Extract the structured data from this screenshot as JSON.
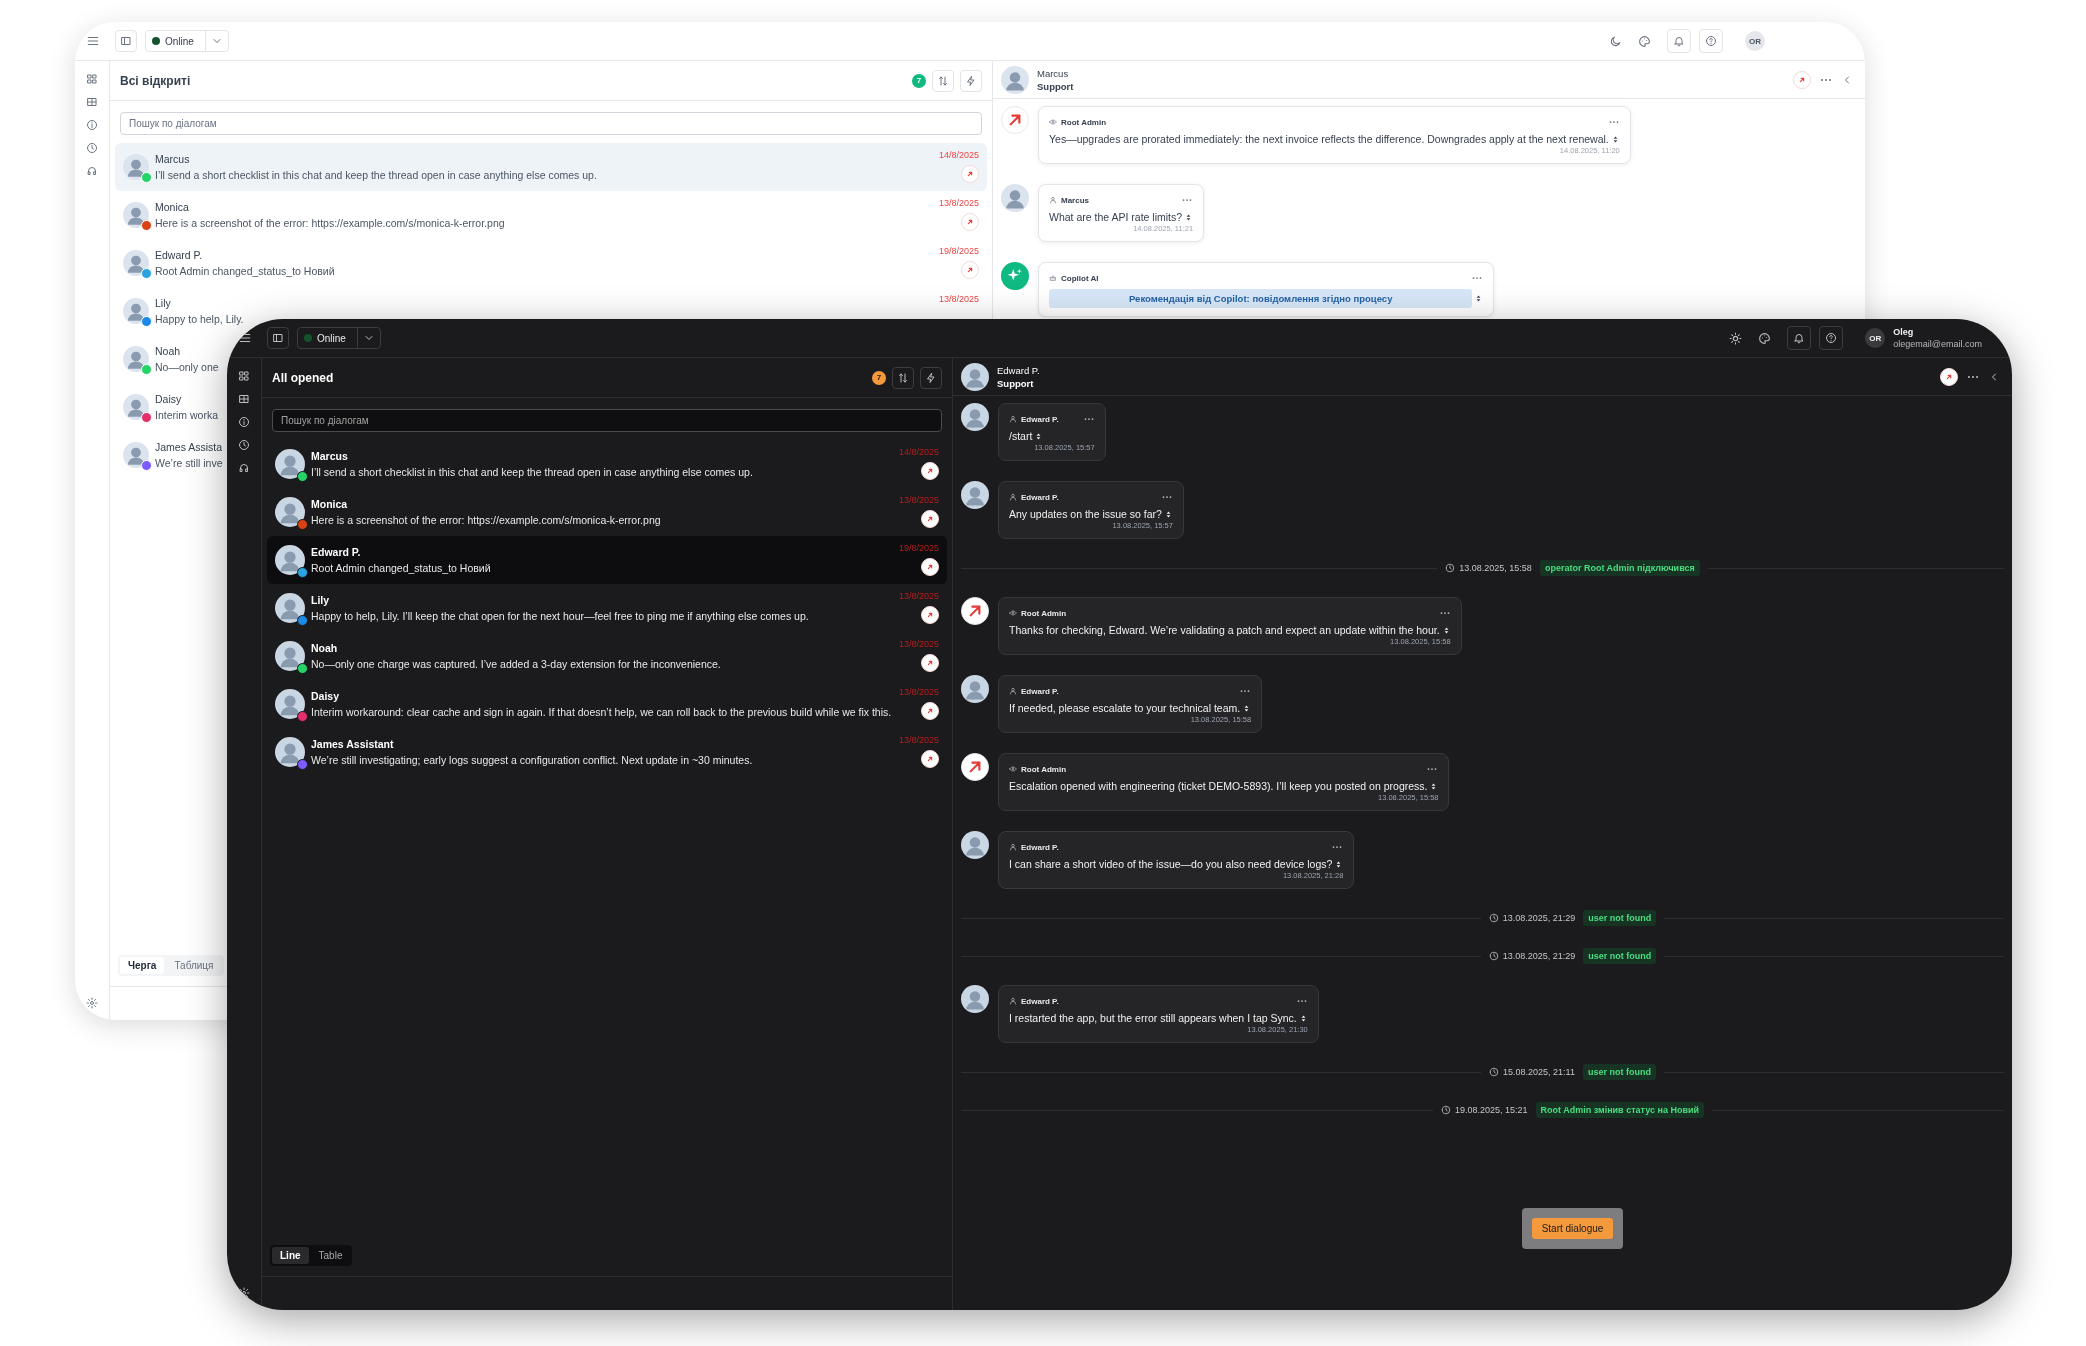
{
  "windows": [
    {
      "kind": "light",
      "topbar": {
        "status": "Online",
        "avatar": "OR"
      },
      "list": {
        "title": "Всі відкриті",
        "count": "7",
        "search": {
          "placeholder": "Пошук по діалогам"
        },
        "conversations": [
          {
            "name": "Marcus",
            "message": "I’ll send a short checklist in this chat and keep the thread open in case anything else comes up.",
            "date": "14/8/2025",
            "flagged": true,
            "selected": true,
            "color": "#25d366"
          },
          {
            "name": "Monica",
            "message": "Here is a screenshot of the error: https://example.com/s/monica-k-error.png",
            "date": "13/8/2025",
            "flagged": true,
            "selected": false,
            "color": "#d84315"
          },
          {
            "name": "Edward P.",
            "message": "Root Admin changed_status_to Новий",
            "date": "19/8/2025",
            "flagged": true,
            "selected": false,
            "color": "#2aa3e0"
          },
          {
            "name": "Lily",
            "message": "Happy to help, Lily.",
            "date": "13/8/2025",
            "flagged": false,
            "selected": false,
            "color": "#1e88e5"
          },
          {
            "name": "Noah",
            "message": "No—only one",
            "flagged": false,
            "selected": false,
            "color": "#25d366"
          },
          {
            "name": "Daisy",
            "message": "Interim worka",
            "flagged": false,
            "selected": false,
            "color": "#e1306c"
          },
          {
            "name": "James Assista",
            "message": "We’re still inve",
            "flagged": false,
            "selected": false,
            "color": "#7c5cff"
          }
        ],
        "tabs": [
          {
            "label": "Черга",
            "selected": true
          },
          {
            "label": "Таблиця",
            "selected": false
          }
        ]
      },
      "chat": {
        "contact": "Marcus",
        "team": "Support",
        "items": [
          {
            "kind": "operator_message",
            "sender": "Root Admin",
            "text": "Yes—upgrades are prorated immediately: the next invoice reflects the difference. Downgrades apply at the next renewal.",
            "time": "14.08.2025, 11:20"
          },
          {
            "kind": "user_message",
            "sender": "Marcus",
            "text": "What are the API rate limits?",
            "time": "14.08.2025, 11:21"
          },
          {
            "kind": "bot_message",
            "sender": "Copilot AI",
            "banner": "Рекомендація від Copilot: повідомлення згідно процесу"
          }
        ]
      }
    },
    {
      "kind": "dark",
      "topbar": {
        "status": "Online",
        "avatar": "OR",
        "user": {
          "name": "Oleg",
          "email": "olegemail@email.com"
        }
      },
      "list": {
        "title": "All opened",
        "count": "7",
        "search": {
          "placeholder": "Пошук по діалогам"
        },
        "conversations": [
          {
            "name": "Marcus",
            "message": "I’ll send a short checklist in this chat and keep the thread open in case anything else comes up.",
            "date": "14/8/2025",
            "flagged": true,
            "selected": false,
            "color": "#25d366"
          },
          {
            "name": "Monica",
            "message": "Here is a screenshot of the error: https://example.com/s/monica-k-error.png",
            "date": "13/8/2025",
            "flagged": true,
            "selected": false,
            "color": "#d84315"
          },
          {
            "name": "Edward P.",
            "message": "Root Admin changed_status_to Новий",
            "date": "19/8/2025",
            "flagged": true,
            "selected": true,
            "color": "#2aa3e0"
          },
          {
            "name": "Lily",
            "message": "Happy to help, Lily. I’ll keep the chat open for the next hour—feel free to ping me if anything else comes up.",
            "date": "13/8/2025",
            "flagged": true,
            "selected": false,
            "color": "#1e88e5"
          },
          {
            "name": "Noah",
            "message": "No—only one charge was captured. I’ve added a 3-day extension for the inconvenience.",
            "date": "13/8/2025",
            "flagged": true,
            "selected": false,
            "color": "#25d366"
          },
          {
            "name": "Daisy",
            "message": "Interim workaround: clear cache and sign in again. If that doesn’t help, we can roll back to the previous build while we fix this.",
            "date": "13/8/2025",
            "flagged": true,
            "selected": false,
            "color": "#e1306c"
          },
          {
            "name": "James Assistant",
            "message": "We’re still investigating; early logs suggest a configuration conflict. Next update in ~30 minutes.",
            "date": "13/8/2025",
            "flagged": true,
            "selected": false,
            "color": "#7c5cff"
          }
        ],
        "tabs": [
          {
            "label": "Line",
            "selected": true
          },
          {
            "label": "Table",
            "selected": false
          }
        ]
      },
      "chat": {
        "contact": "Edward P.",
        "team": "Support",
        "items": [
          {
            "kind": "user_message",
            "sender": "Edward P.",
            "text": "/start",
            "time": "13.08.2025, 15:57"
          },
          {
            "kind": "user_message",
            "sender": "Edward P.",
            "text": "Any updates on the issue so far?",
            "time": "13.08.2025, 15:57"
          },
          {
            "kind": "event",
            "time": "13.08.2025, 15:58",
            "tag": "operator Root Admin підключився"
          },
          {
            "kind": "operator_message",
            "sender": "Root Admin",
            "text": "Thanks for checking, Edward. We’re validating a patch and expect an update within the hour.",
            "time": "13.08.2025, 15:58"
          },
          {
            "kind": "user_message",
            "sender": "Edward P.",
            "text": "If needed, please escalate to your technical team.",
            "time": "13.08.2025, 15:58"
          },
          {
            "kind": "operator_message",
            "sender": "Root Admin",
            "text": "Escalation opened with engineering (ticket DEMO-5893). I’ll keep you posted on progress.",
            "time": "13.08.2025, 15:58"
          },
          {
            "kind": "user_message",
            "sender": "Edward P.",
            "text": "I can share a short video of the issue—do you also need device logs?",
            "time": "13.08.2025, 21:28"
          },
          {
            "kind": "event",
            "time": "13.08.2025, 21:29",
            "tag": "user not found"
          },
          {
            "kind": "event",
            "time": "13.08.2025, 21:29",
            "tag": "user not found"
          },
          {
            "kind": "user_message",
            "sender": "Edward P.",
            "text": "I restarted the app, but the error still appears when I tap Sync.",
            "time": "13.08.2025, 21:30"
          },
          {
            "kind": "event",
            "time": "15.08.2025, 21:11",
            "tag": "user not found"
          },
          {
            "kind": "event",
            "time": "19.08.2025, 15:21",
            "tag": "Root Admin змінив статус на Новий"
          }
        ],
        "action": "Start dialogue"
      }
    }
  ]
}
